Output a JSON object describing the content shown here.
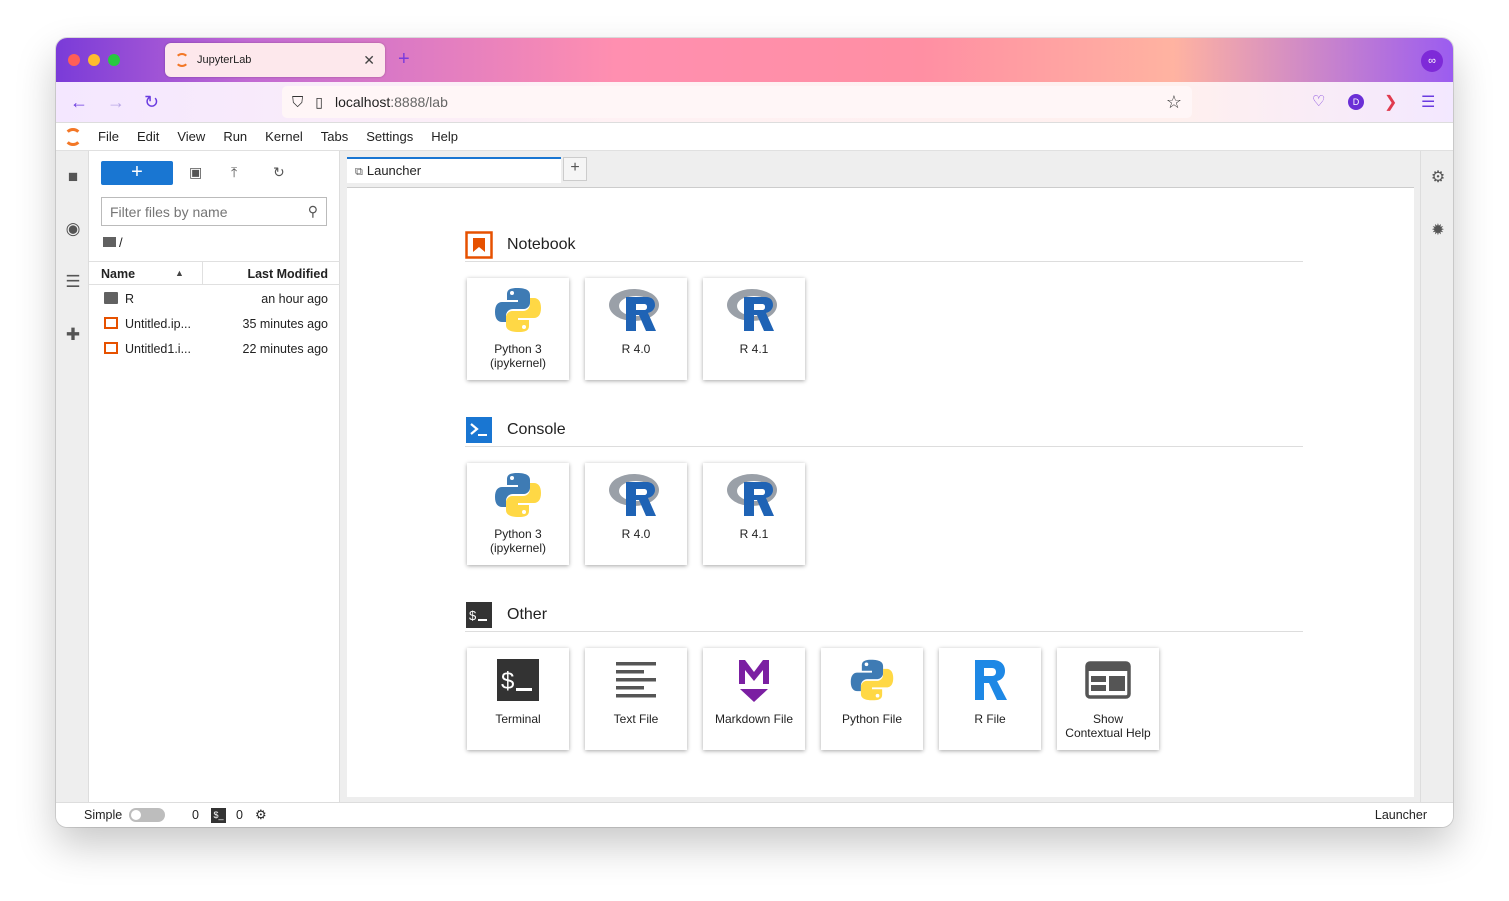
{
  "browser": {
    "tab_title": "JupyterLab",
    "url_host": "localhost",
    "url_path": ":8888/lab",
    "account_initial": "D",
    "colors": {
      "close": "#ff5f57",
      "minimize": "#febc2e",
      "zoom": "#28c840"
    }
  },
  "menu": {
    "items": [
      "File",
      "Edit",
      "View",
      "Run",
      "Kernel",
      "Tabs",
      "Settings",
      "Help"
    ]
  },
  "file_browser": {
    "filter_placeholder": "Filter files by name",
    "breadcrumb": "/",
    "columns": {
      "name": "Name",
      "modified": "Last Modified"
    },
    "files": [
      {
        "name": "R",
        "modified": "an hour ago",
        "type": "folder"
      },
      {
        "name": "Untitled.ip...",
        "modified": "35 minutes ago",
        "type": "notebook"
      },
      {
        "name": "Untitled1.i...",
        "modified": "22 minutes ago",
        "type": "notebook"
      }
    ]
  },
  "main_tab": {
    "label": "Launcher"
  },
  "launcher": {
    "notebook": {
      "title": "Notebook",
      "items": [
        "Python 3\n(ipykernel)",
        "R 4.0",
        "R 4.1"
      ]
    },
    "console": {
      "title": "Console",
      "items": [
        "Python 3\n(ipykernel)",
        "R 4.0",
        "R 4.1"
      ]
    },
    "other": {
      "title": "Other",
      "items": [
        "Terminal",
        "Text File",
        "Markdown File",
        "Python File",
        "R File",
        "Show\nContextual Help"
      ]
    }
  },
  "status": {
    "mode": "Simple",
    "kernels": "0",
    "terminals": "0",
    "right": "Launcher"
  }
}
